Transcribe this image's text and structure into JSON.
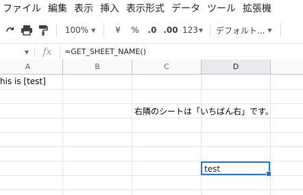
{
  "menu": [
    "ファイル",
    "編集",
    "表示",
    "挿入",
    "表示形式",
    "データ",
    "ツール",
    "拡張機"
  ],
  "toolbar": {
    "zoom": "100%",
    "currency": "¥",
    "percent": "%",
    "dec_decrease": ".0",
    "dec_increase": ".00",
    "number_format": "123",
    "font": "デフォルト..."
  },
  "formula_bar": {
    "fx": "fx",
    "formula": "=GET_SHEET_NAME()"
  },
  "columns": [
    "A",
    "B",
    "C",
    "D"
  ],
  "cells": {
    "a1": "his is [test]",
    "c3": "右隣のシートは「いちばん右」です。",
    "d7": "test"
  }
}
